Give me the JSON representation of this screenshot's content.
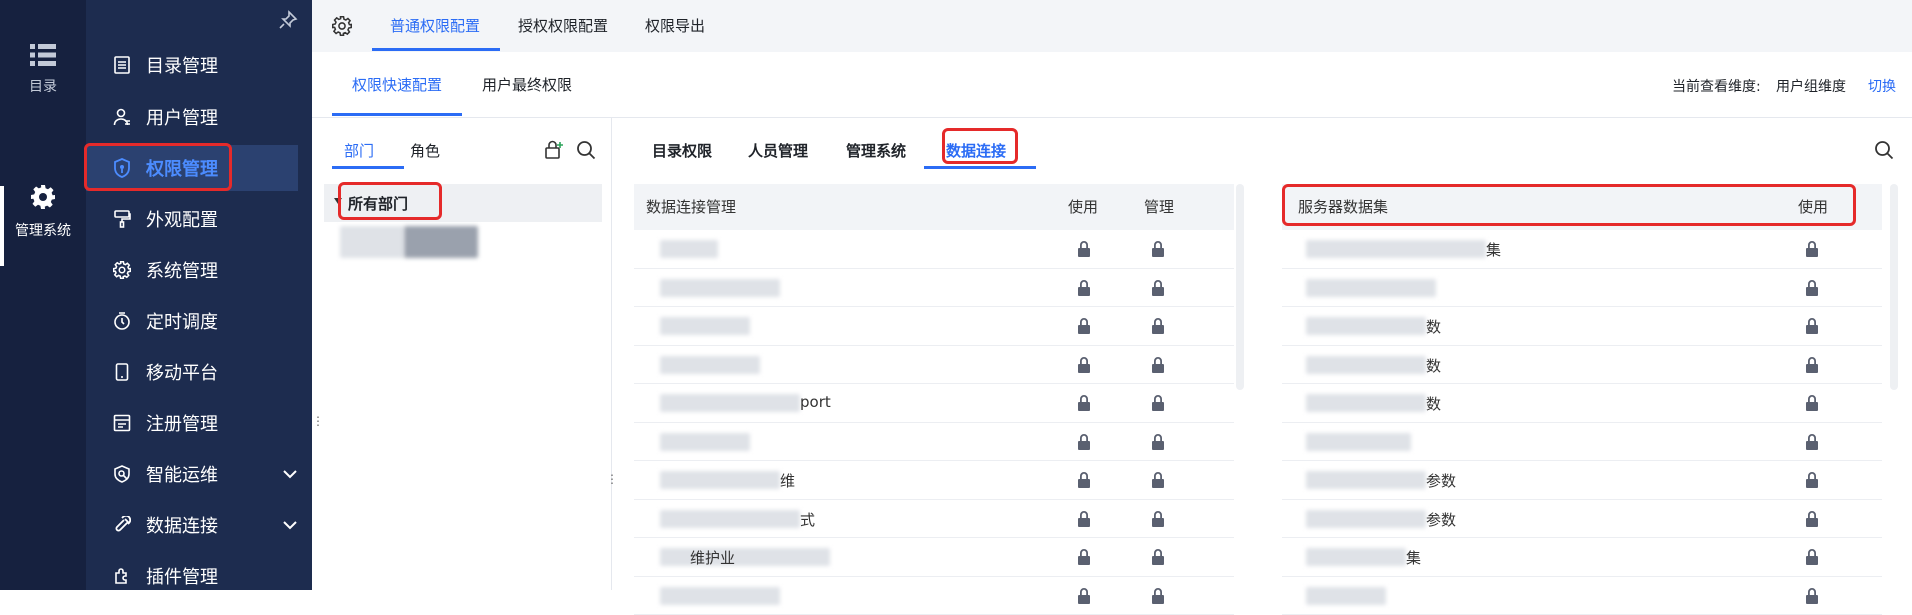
{
  "rail": {
    "items": [
      {
        "label": "目录",
        "icon": "list-icon"
      },
      {
        "label": "管理系统",
        "icon": "gear-icon"
      }
    ]
  },
  "sidebar": {
    "items": [
      {
        "label": "目录管理",
        "icon": "catalog-icon"
      },
      {
        "label": "用户管理",
        "icon": "user-icon"
      },
      {
        "label": "权限管理",
        "icon": "shield-icon"
      },
      {
        "label": "外观配置",
        "icon": "paint-icon"
      },
      {
        "label": "系统管理",
        "icon": "gear-icon"
      },
      {
        "label": "定时调度",
        "icon": "timer-icon"
      },
      {
        "label": "移动平台",
        "icon": "mobile-icon"
      },
      {
        "label": "注册管理",
        "icon": "register-icon"
      },
      {
        "label": "智能运维",
        "icon": "ops-icon"
      },
      {
        "label": "数据连接",
        "icon": "link-icon"
      },
      {
        "label": "插件管理",
        "icon": "plugin-icon"
      }
    ]
  },
  "top_tabs": [
    "普通权限配置",
    "授权权限配置",
    "权限导出"
  ],
  "sub_tabs": [
    "权限快速配置",
    "用户最终权限"
  ],
  "dimension": {
    "label": "当前查看维度:",
    "value": "用户组维度",
    "switch": "切换"
  },
  "left_pane": {
    "tabs": [
      "部门",
      "角色"
    ],
    "root": "所有部门"
  },
  "middle_tabs": [
    "目录权限",
    "人员管理",
    "管理系统",
    "数据连接"
  ],
  "data_conn_table": {
    "headers": [
      "数据连接管理",
      "使用",
      "管理"
    ],
    "row_suffixes": [
      "",
      "",
      "",
      "",
      "port",
      "",
      "维",
      "式",
      "",
      ""
    ],
    "row_prefixes": [
      "",
      "",
      "",
      "",
      "",
      "",
      "",
      "",
      "维护业",
      ""
    ]
  },
  "server_table": {
    "headers": [
      "服务器数据集",
      "使用"
    ],
    "row_suffixes": [
      "集",
      "",
      "数",
      "数",
      "数",
      "",
      "参数",
      "参数",
      "集",
      ""
    ]
  },
  "colors": {
    "accent": "#2b6cf5",
    "sidebar_bg": "#1d2c4f",
    "rail_bg": "#16213f",
    "highlight": "#e52a2a"
  }
}
